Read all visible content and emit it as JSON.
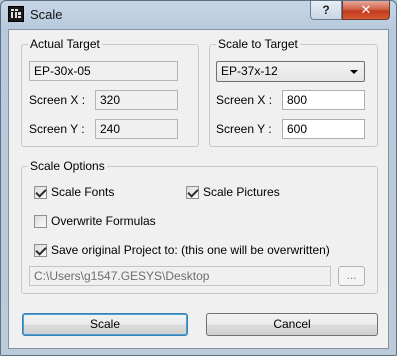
{
  "window": {
    "title": "Scale",
    "help_glyph": "?",
    "close_glyph": "✕",
    "icon": "app-icon"
  },
  "actual_target": {
    "legend": "Actual Target",
    "name_value": "EP-30x-05",
    "screen_x_label": "Screen X :",
    "screen_x_value": "320",
    "screen_y_label": "Screen Y :",
    "screen_y_value": "240"
  },
  "scale_to_target": {
    "legend": "Scale to Target",
    "selected": "EP-37x-12",
    "screen_x_label": "Screen X :",
    "screen_x_value": "800",
    "screen_y_label": "Screen Y :",
    "screen_y_value": "600"
  },
  "scale_options": {
    "legend": "Scale Options",
    "scale_fonts_label": "Scale Fonts",
    "scale_fonts_checked": true,
    "scale_pictures_label": "Scale Pictures",
    "scale_pictures_checked": true,
    "overwrite_formulas_label": "Overwrite Formulas",
    "overwrite_formulas_checked": false,
    "save_original_label": "Save original Project to: (this one will be overwritten)",
    "save_original_checked": true,
    "path_value": "C:\\Users\\g1547.GESYS\\Desktop",
    "browse_label": "..."
  },
  "buttons": {
    "scale_label": "Scale",
    "cancel_label": "Cancel"
  }
}
